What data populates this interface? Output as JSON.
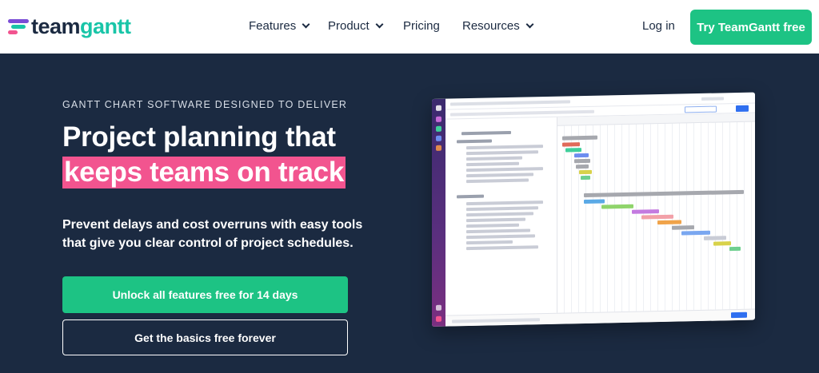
{
  "brand": {
    "team": "team",
    "gantt": "gantt",
    "colors": [
      "#7b4dd6",
      "#19c5a8",
      "#f2548f"
    ]
  },
  "nav": {
    "features": "Features",
    "product": "Product",
    "pricing": "Pricing",
    "resources": "Resources",
    "login": "Log in",
    "cta": "Try TeamGantt free"
  },
  "hero": {
    "eyebrow": "GANTT CHART SOFTWARE DESIGNED TO DELIVER",
    "title_line1": "Project planning that",
    "title_line2": "keeps teams on track",
    "sub_line1": "Prevent delays and cost overruns with easy tools",
    "sub_line2": "that give you clear control of project schedules.",
    "primary_button": "Unlock all features free for 14 days",
    "secondary_button": "Get the basics free forever"
  },
  "colors": {
    "background": "#1b2a41",
    "accent_green": "#1dc384",
    "highlight_pink": "#f2548f"
  }
}
